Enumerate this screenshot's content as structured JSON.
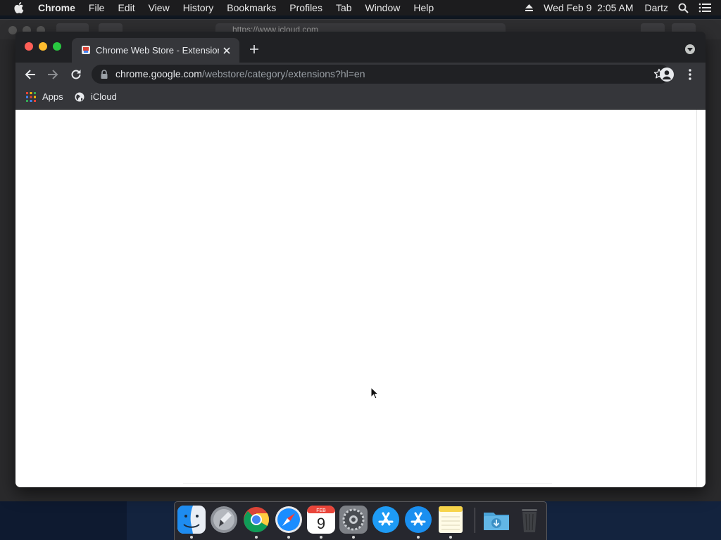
{
  "menubar": {
    "app_name": "Chrome",
    "menus": [
      "File",
      "Edit",
      "View",
      "History",
      "Bookmarks",
      "Profiles",
      "Tab",
      "Window",
      "Help"
    ],
    "clock": "Wed Feb 9  2:05 AM",
    "user": "Dartz"
  },
  "background_window": {
    "url": "https://www.icloud.com"
  },
  "chrome": {
    "tab": {
      "title": "Chrome Web Store - Extensions"
    },
    "omnibox": {
      "host": "chrome.google.com",
      "path": "/webstore/category/extensions?hl=en"
    },
    "bookmarks": [
      {
        "label": "Apps",
        "icon": "apps-grid-icon"
      },
      {
        "label": "iCloud",
        "icon": "globe-icon"
      }
    ]
  },
  "dock": {
    "items": [
      {
        "name": "finder-icon",
        "running": true
      },
      {
        "name": "launchpad-icon",
        "running": false
      },
      {
        "name": "chrome-icon",
        "running": true
      },
      {
        "name": "safari-icon",
        "running": true
      },
      {
        "name": "calendar-icon",
        "running": true,
        "month": "FEB",
        "day": "9"
      },
      {
        "name": "system-preferences-icon",
        "running": true
      },
      {
        "name": "app-store-icon",
        "running": false
      },
      {
        "name": "app-store-icon",
        "running": true
      },
      {
        "name": "notes-icon",
        "running": true
      },
      {
        "name": "downloads-folder-icon",
        "running": false
      },
      {
        "name": "trash-icon",
        "running": false
      }
    ]
  },
  "colors": {
    "menubar_bg": "#1c1c1e",
    "chrome_frame": "#202124",
    "chrome_toolbar": "#35363a",
    "close": "#fe5f57",
    "minimize": "#febc2e",
    "maximize": "#28c840"
  }
}
